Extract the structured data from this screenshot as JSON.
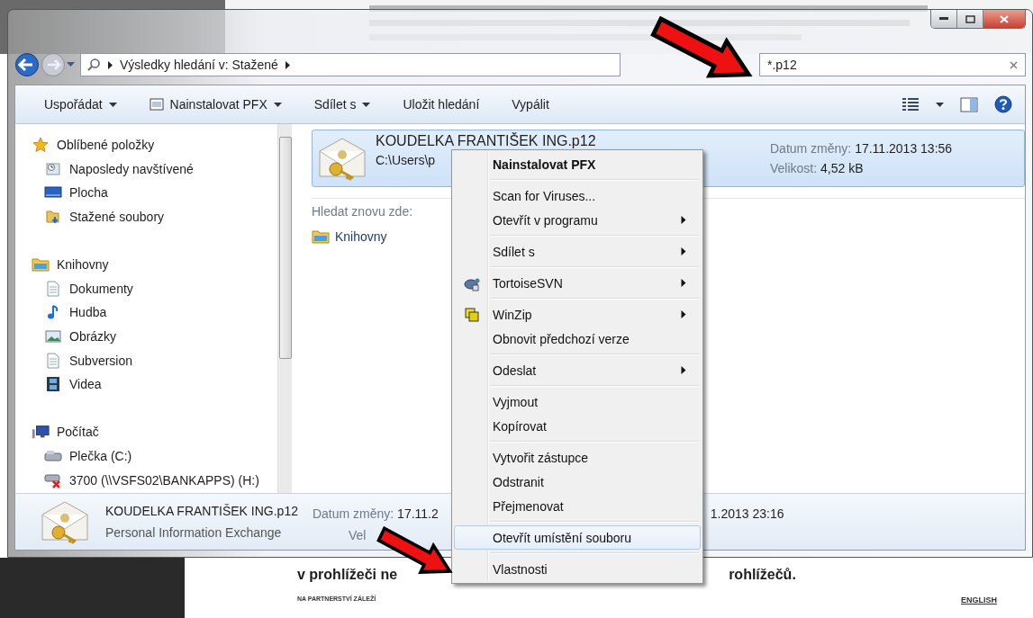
{
  "address_bar": {
    "path": "Výsledky hledání v: Stažené"
  },
  "search": {
    "value": "*.p12"
  },
  "toolbar": {
    "items": [
      {
        "label": "Uspořádat",
        "dropdown": true,
        "kind": "plain"
      },
      {
        "label": "Nainstalovat PFX",
        "dropdown": true,
        "kind": "install"
      },
      {
        "label": "Sdílet s",
        "dropdown": true,
        "kind": "plain"
      },
      {
        "label": "Uložit hledání",
        "dropdown": false,
        "kind": "plain"
      },
      {
        "label": "Vypálit",
        "dropdown": false,
        "kind": "plain"
      }
    ]
  },
  "sidebar": {
    "groups": [
      {
        "label": "Oblíbené položky",
        "kind": "star",
        "children": [
          {
            "label": "Naposledy navštívené",
            "kind": "recent"
          },
          {
            "label": "Plocha",
            "kind": "desktop"
          },
          {
            "label": "Stažené soubory",
            "kind": "downloads"
          }
        ]
      },
      {
        "label": "Knihovny",
        "kind": "library",
        "children": [
          {
            "label": "Dokumenty",
            "kind": "documents"
          },
          {
            "label": "Hudba",
            "kind": "music"
          },
          {
            "label": "Obrázky",
            "kind": "pictures"
          },
          {
            "label": "Subversion",
            "kind": "documents"
          },
          {
            "label": "Videa",
            "kind": "videos"
          }
        ]
      },
      {
        "label": "Počítač",
        "kind": "computer",
        "children": [
          {
            "label": "Plečka (C:)",
            "kind": "drive"
          },
          {
            "label": "3700 (\\\\VSFS02\\BANKAPPS) (H:)",
            "kind": "network"
          }
        ]
      }
    ]
  },
  "results": [
    {
      "name": "KOUDELKA FRANTIŠEK ING.p12",
      "path": "C:\\Users\\p",
      "date_label": "Datum změny:",
      "date": "17.11.2013 13:56",
      "size_label": "Velikost:",
      "size": "4,52 kB",
      "selected": true
    }
  ],
  "search_again": {
    "label": "Hledat znovu zde:",
    "locations": [
      {
        "label": "Knihovny"
      }
    ]
  },
  "context_menu": {
    "sections": [
      [
        {
          "label": "Nainstalovat PFX",
          "bold": true,
          "submenu": false,
          "selected": false,
          "kind": "plain"
        }
      ],
      [
        {
          "label": "Scan for Viruses...",
          "bold": false,
          "submenu": false,
          "selected": false,
          "kind": "plain"
        },
        {
          "label": "Otevřít v programu",
          "bold": false,
          "submenu": true,
          "selected": false,
          "kind": "plain"
        }
      ],
      [
        {
          "label": "Sdílet s",
          "bold": false,
          "submenu": true,
          "selected": false,
          "kind": "plain"
        }
      ],
      [
        {
          "label": "TortoiseSVN",
          "bold": false,
          "submenu": true,
          "selected": false,
          "kind": "turtle"
        }
      ],
      [
        {
          "label": "WinZip",
          "bold": false,
          "submenu": true,
          "selected": false,
          "kind": "archive"
        },
        {
          "label": "Obnovit předchozí verze",
          "bold": false,
          "submenu": false,
          "selected": false,
          "kind": "plain"
        }
      ],
      [
        {
          "label": "Odeslat",
          "bold": false,
          "submenu": true,
          "selected": false,
          "kind": "plain"
        }
      ],
      [
        {
          "label": "Vyjmout",
          "bold": false,
          "submenu": false,
          "selected": false,
          "kind": "plain"
        },
        {
          "label": "Kopírovat",
          "bold": false,
          "submenu": false,
          "selected": false,
          "kind": "plain"
        }
      ],
      [
        {
          "label": "Vytvořit zástupce",
          "bold": false,
          "submenu": false,
          "selected": false,
          "kind": "plain"
        },
        {
          "label": "Odstranit",
          "bold": false,
          "submenu": false,
          "selected": false,
          "kind": "plain"
        },
        {
          "label": "Přejmenovat",
          "bold": false,
          "submenu": false,
          "selected": false,
          "kind": "plain"
        }
      ],
      [
        {
          "label": "Otevřít umístění souboru",
          "bold": false,
          "submenu": false,
          "selected": true,
          "kind": "plain"
        }
      ],
      [
        {
          "label": "Vlastnosti",
          "bold": false,
          "submenu": false,
          "selected": false,
          "kind": "plain"
        }
      ]
    ]
  },
  "details": {
    "name": "KOUDELKA FRANTIŠEK ING.p12",
    "type": "Personal Information Exchange",
    "date_label": "Datum změny:",
    "date_fragment": "17.11.2",
    "date_tail": "1.2013 23:16",
    "size_fragment": "Vel"
  },
  "backdrop": {
    "line_start": "v prohlížeči ne",
    "line_end": "rohlížečů.",
    "brand": "NA PARTNERSTVÍ ZÁLEŽÍ",
    "language": "ENGLISH"
  }
}
